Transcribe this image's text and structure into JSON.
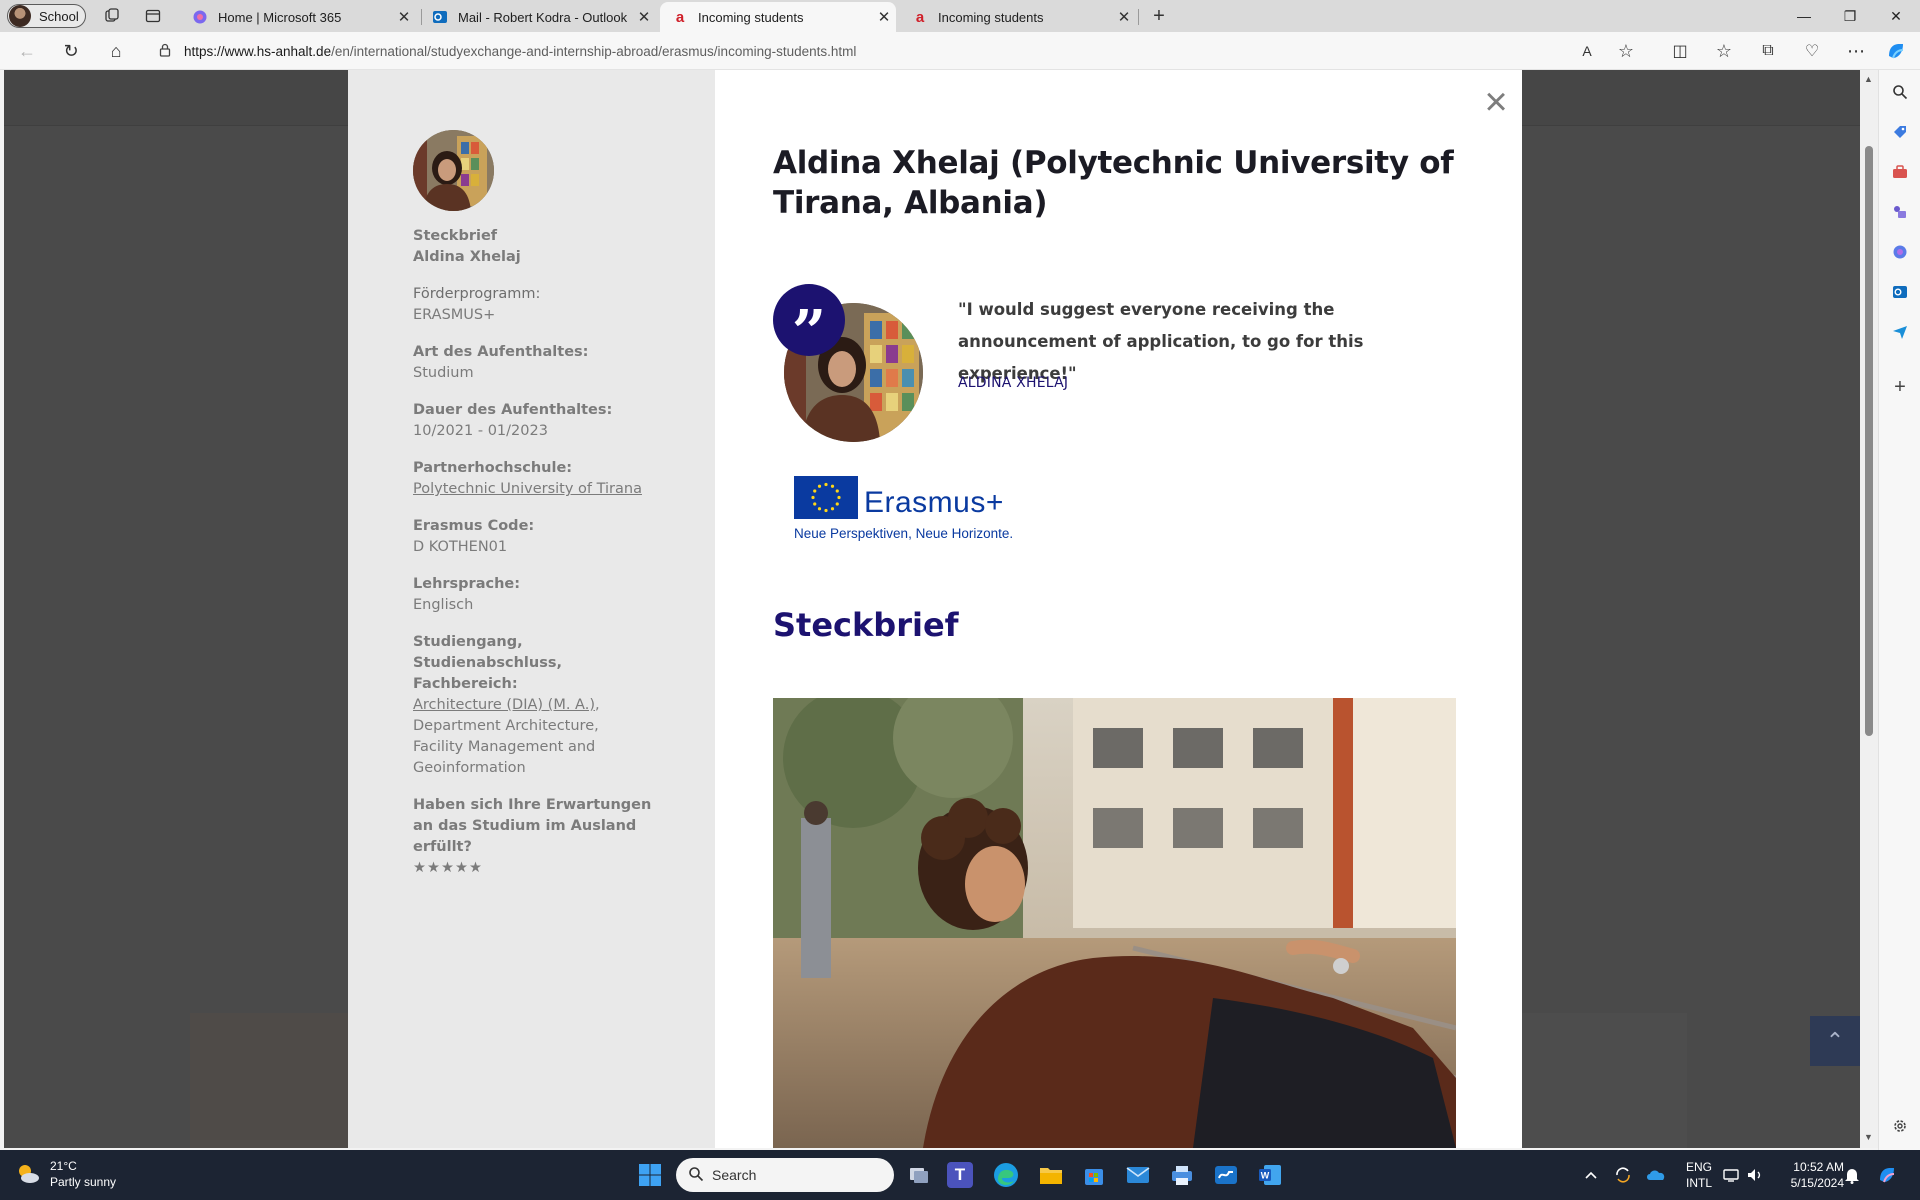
{
  "browser": {
    "profile_label": "School",
    "tabs": [
      {
        "title": "Home | Microsoft 365",
        "active": false
      },
      {
        "title": "Mail - Robert Kodra - Outlook",
        "active": false
      },
      {
        "title": "Incoming students",
        "active": true
      },
      {
        "title": "Incoming students",
        "active": false
      }
    ],
    "url_host": "https://www.hs-anhalt.de",
    "url_path": "/en/international/studyexchange-and-internship-abroad/erasmus/incoming-students.html",
    "icons": {
      "back": "←",
      "refresh": "↻",
      "home": "⌂",
      "lock": "🔒",
      "read_aloud": "A",
      "favorite": "☆",
      "split": "◫",
      "favorites": "☆",
      "collections": "⧉",
      "extensions": "♡",
      "more": "⋯",
      "new_tab": "+",
      "minimize": "—",
      "restore": "❐",
      "close": "✕",
      "tab_close": "✕"
    }
  },
  "modal": {
    "close_label": "×",
    "title": "Aldina Xhelaj (Polytechnic University of Tirana, Albania)",
    "quote": "\"I would suggest everyone receiving the announcement of application, to go for this experience!\"",
    "quote_author": "ALDINA XHELAJ",
    "quote_mark": "”",
    "logo": {
      "word": "Erasmus+",
      "tagline": "Neue Perspektiven, Neue Horizonte."
    },
    "section_heading": "Steckbrief",
    "facts": {
      "heading": "Steckbrief",
      "name": "Aldina Xhelaj",
      "program_label": "Förderprogramm:",
      "program_value": "ERASMUS+",
      "stay_type_label": "Art des Aufenthaltes:",
      "stay_type_value": "Studium",
      "duration_label": "Dauer des Aufenthaltes:",
      "duration_value": "10/2021 - 01/2023",
      "partner_label": "Partnerhochschule:",
      "partner_value": "Polytechnic University of Tirana",
      "code_label": "Erasmus Code:",
      "code_value": "D KOTHEN01",
      "language_label": "Lehrsprache:",
      "language_value": "Englisch",
      "course_label": "Studiengang, Studienabschluss, Fachbereich:",
      "course_link": "Architecture (DIA) (M. A.)",
      "course_rest": ", Department Architecture, Facility Management and Geoinformation",
      "expectations_label": "Haben sich Ihre Erwartungen an das Studium im Ausland erfüllt?",
      "rating": 5,
      "rating_stars": "★★★★★"
    }
  },
  "page": {
    "scroll_top_icon": "⌃"
  },
  "taskbar": {
    "temperature": "21°C",
    "weather": "Partly sunny",
    "search_placeholder": "Search",
    "lang_line1": "ENG",
    "lang_line2": "INTL",
    "time": "10:52 AM",
    "date": "5/15/2024"
  },
  "colors": {
    "accent_navy": "#1c1270",
    "erasmus_blue": "#0a3aa0",
    "overlay": "#4a4a4a",
    "taskbar": "#1c2433"
  }
}
